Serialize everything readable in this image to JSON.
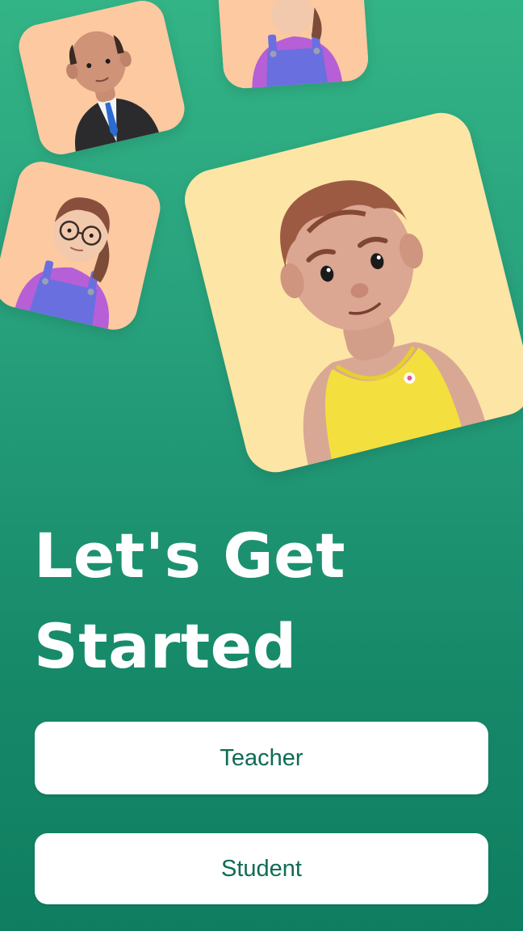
{
  "headline": {
    "line1": "Let's Get",
    "line2": "Started"
  },
  "buttons": {
    "teacher_label": "Teacher",
    "student_label": "Student"
  },
  "avatars": [
    {
      "name": "teacher-avatar",
      "card_color": "#fcc9a1"
    },
    {
      "name": "student-girl-avatar",
      "card_color": "#fcc9a1"
    },
    {
      "name": "girl-with-glasses-avatar",
      "card_color": "#fcc9a1"
    },
    {
      "name": "boy-avatar",
      "card_color": "#fde5a6"
    }
  ],
  "colors": {
    "background_top": "#33b486",
    "background_bottom": "#0f7e60",
    "button_text": "#0f6b55",
    "headline": "#ffffff"
  }
}
